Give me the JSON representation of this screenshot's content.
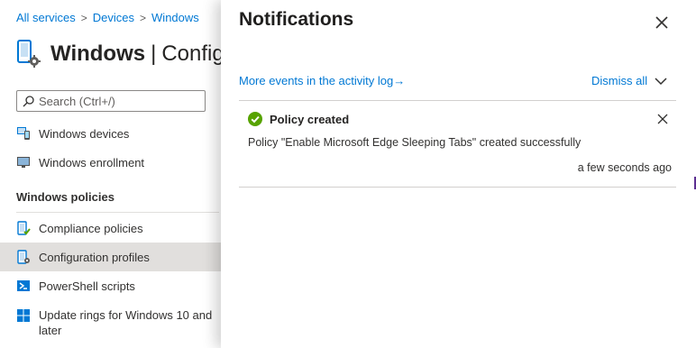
{
  "breadcrumb": {
    "items": [
      "All services",
      "Devices",
      "Windows"
    ],
    "separator": ">"
  },
  "page": {
    "title_bold": "Windows",
    "title_separator": "|",
    "title_rest": "Configuration profiles"
  },
  "search": {
    "placeholder": "Search (Ctrl+/)"
  },
  "nav": {
    "top_items": [
      {
        "label": "Windows devices",
        "icon": "windows-devices-icon"
      },
      {
        "label": "Windows enrollment",
        "icon": "windows-enrollment-icon"
      }
    ],
    "section_header": "Windows policies",
    "policy_items": [
      {
        "label": "Compliance policies",
        "icon": "compliance-policy-icon"
      },
      {
        "label": "Configuration profiles",
        "icon": "configuration-profile-icon",
        "selected": true
      },
      {
        "label": "PowerShell scripts",
        "icon": "powershell-icon"
      },
      {
        "label_line1": "Update rings for Windows 10 and",
        "label_line2": "later",
        "icon": "windows-logo-icon"
      }
    ]
  },
  "notifications": {
    "title": "Notifications",
    "activity_link": "More events in the activity log",
    "activity_arrow": "→",
    "dismiss_all": "Dismiss all",
    "items": [
      {
        "status": "success",
        "title": "Policy created",
        "message": "Policy \"Enable Microsoft Edge Sleeping Tabs\" created successfully",
        "time": "a few seconds ago"
      }
    ]
  },
  "colors": {
    "link": "#0078d4",
    "success": "#57a300",
    "selected_bg": "#e1dfdd"
  }
}
